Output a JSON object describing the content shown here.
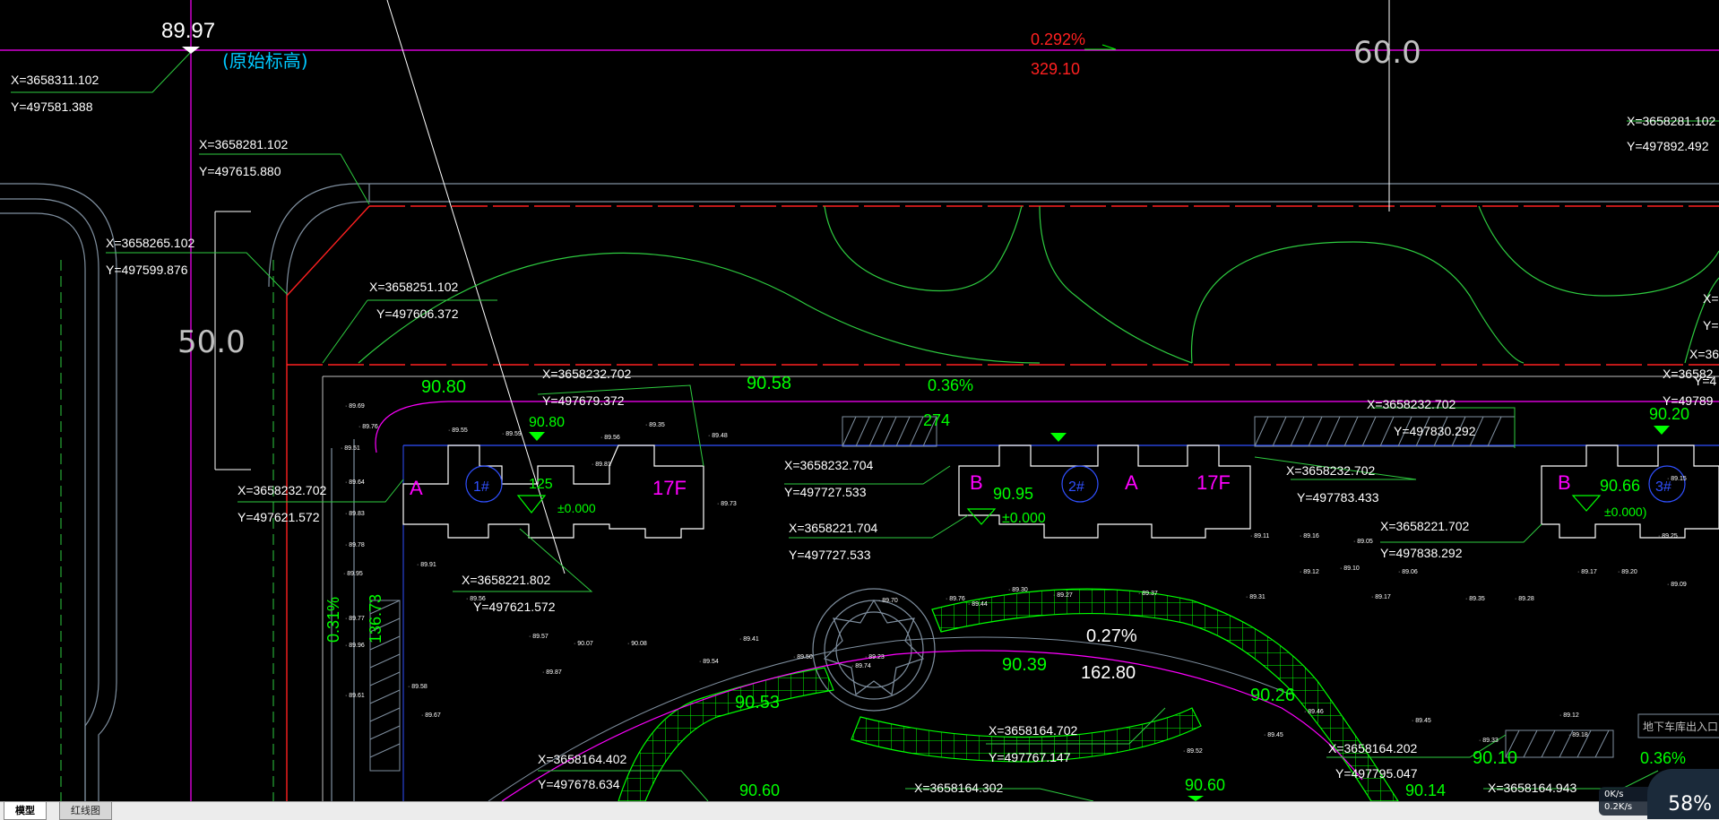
{
  "colors": {
    "background": "#000000",
    "green": "#00ff00",
    "dim_green": "#2ecc40",
    "magenta": "#ff00ff",
    "red": "#ff2020",
    "white": "#ffffff",
    "cyan": "#00c8ff",
    "blue": "#3050ff",
    "gray": "#7f8f9f"
  },
  "labels": {
    "top_elev": "89.97",
    "original_elev": "(原始标高)",
    "slope_top": "0.292%",
    "slope_top_len": "329.10",
    "dim_60": "60.0",
    "dim_50": "50.0",
    "pt1_x": "X=3658311.102",
    "pt1_y": "Y=497581.388",
    "pt2_x": "X=3658281.102",
    "pt2_y": "Y=497615.880",
    "pt3_x": "X=3658265.102",
    "pt3_y": "Y=497599.876",
    "pt4_x": "X=3658251.102",
    "pt4_y": "Y=497606.372",
    "pt5_x": "X=3658232.702",
    "pt5_y": "Y=497621.572",
    "pt6_x": "X=3658232.702",
    "pt6_y": "Y=497679.372",
    "pt7_x": "X=3658221.802",
    "pt7_y": "Y=497621.572",
    "pt8_x": "X=3658232.704",
    "pt8_y": "Y=497727.533",
    "pt9_x": "X=3658221.704",
    "pt9_y": "Y=497727.533",
    "pt10_x": "X=3658232.702",
    "pt10_y": "Y=497830.292",
    "pt11_x": "X=3658232.702",
    "pt11_y": "Y=497783.433",
    "pt12_x": "X=3658221.702",
    "pt12_y": "Y=497838.292",
    "pt13_x": "X=3658281.102",
    "pt13_y": "Y=497892.492",
    "pt14_x": "X=3658164.402",
    "pt14_y": "Y=497678.634",
    "pt15_x": "X=3658164.702",
    "pt15_y": "Y=497767.147",
    "pt16_x": "X=3658164.302",
    "pt17_x": "X=3658164.202",
    "pt17_y": "Y=497795.047",
    "pt18_x": "X=3658164.943",
    "edge_x1": "X=",
    "edge_y1": "Y=",
    "edge_x2": "X=36",
    "edge_y2": "Y=4",
    "edge_x3": "X=36582",
    "edge_y3": "Y=49789",
    "elev_9080": "90.80",
    "elev_9080b": "90.80",
    "elev_9058": "90.58",
    "slope_036": "0.36%",
    "elev_9020": "90.20",
    "elev_9066": "90.66",
    "elev_9095": "90.95",
    "elev_9039": "90.39",
    "len_16280": "162.80",
    "slope_027": "0.27%",
    "elev_9026": "90.26",
    "elev_9053": "90.53",
    "elev_9060": "90.60",
    "elev_9060b": "90.60",
    "elev_9010": "90.10",
    "elev_9014": "90.14",
    "slope_036b": "0.36%",
    "slope_031": "0.31%",
    "len_13673": "136.73",
    "len_274": "274",
    "pm_000": "±0.000",
    "pm_0000": "±0.000",
    "pm_000b": "±0.000)",
    "val_125": "125",
    "bldg_a": "A",
    "bldg_1": "1#",
    "bldg_17f": "17F",
    "bldg_b": "B",
    "bldg_2": "2#",
    "bldg_a2": "A",
    "bldg_17f2": "17F",
    "bldg_b2": "B",
    "bldg_3": "3#",
    "garage": "地下车库出入口"
  },
  "spots": [
    "89.69",
    "89.76",
    "89.51",
    "89.64",
    "89.83",
    "89.78",
    "89.95",
    "89.77",
    "89.96",
    "89.61",
    "89.58",
    "89.67",
    "89.55",
    "89.59",
    "89.56",
    "89.35",
    "89.48",
    "89.73",
    "89.81",
    "89.91",
    "89.56",
    "89.57",
    "89.87",
    "90.07",
    "90.08",
    "89.54",
    "89.41",
    "89.50",
    "89.74",
    "89.23",
    "89.70",
    "89.76",
    "89.44",
    "89.30",
    "89.27",
    "89.37",
    "89.31",
    "89.17",
    "89.35",
    "89.28",
    "89.11",
    "89.16",
    "89.05",
    "89.12",
    "89.10",
    "89.06",
    "89.17",
    "89.20",
    "89.09",
    "89.25",
    "89.15",
    "89.45",
    "89.12",
    "89.18",
    "89.33",
    "89.46",
    "89.45",
    "89.52"
  ],
  "tabs": [
    {
      "label": "模型"
    },
    {
      "label": "红线图"
    }
  ],
  "status": {
    "zoom": "58%",
    "up": "0K/s",
    "down": "0.2K/s"
  }
}
